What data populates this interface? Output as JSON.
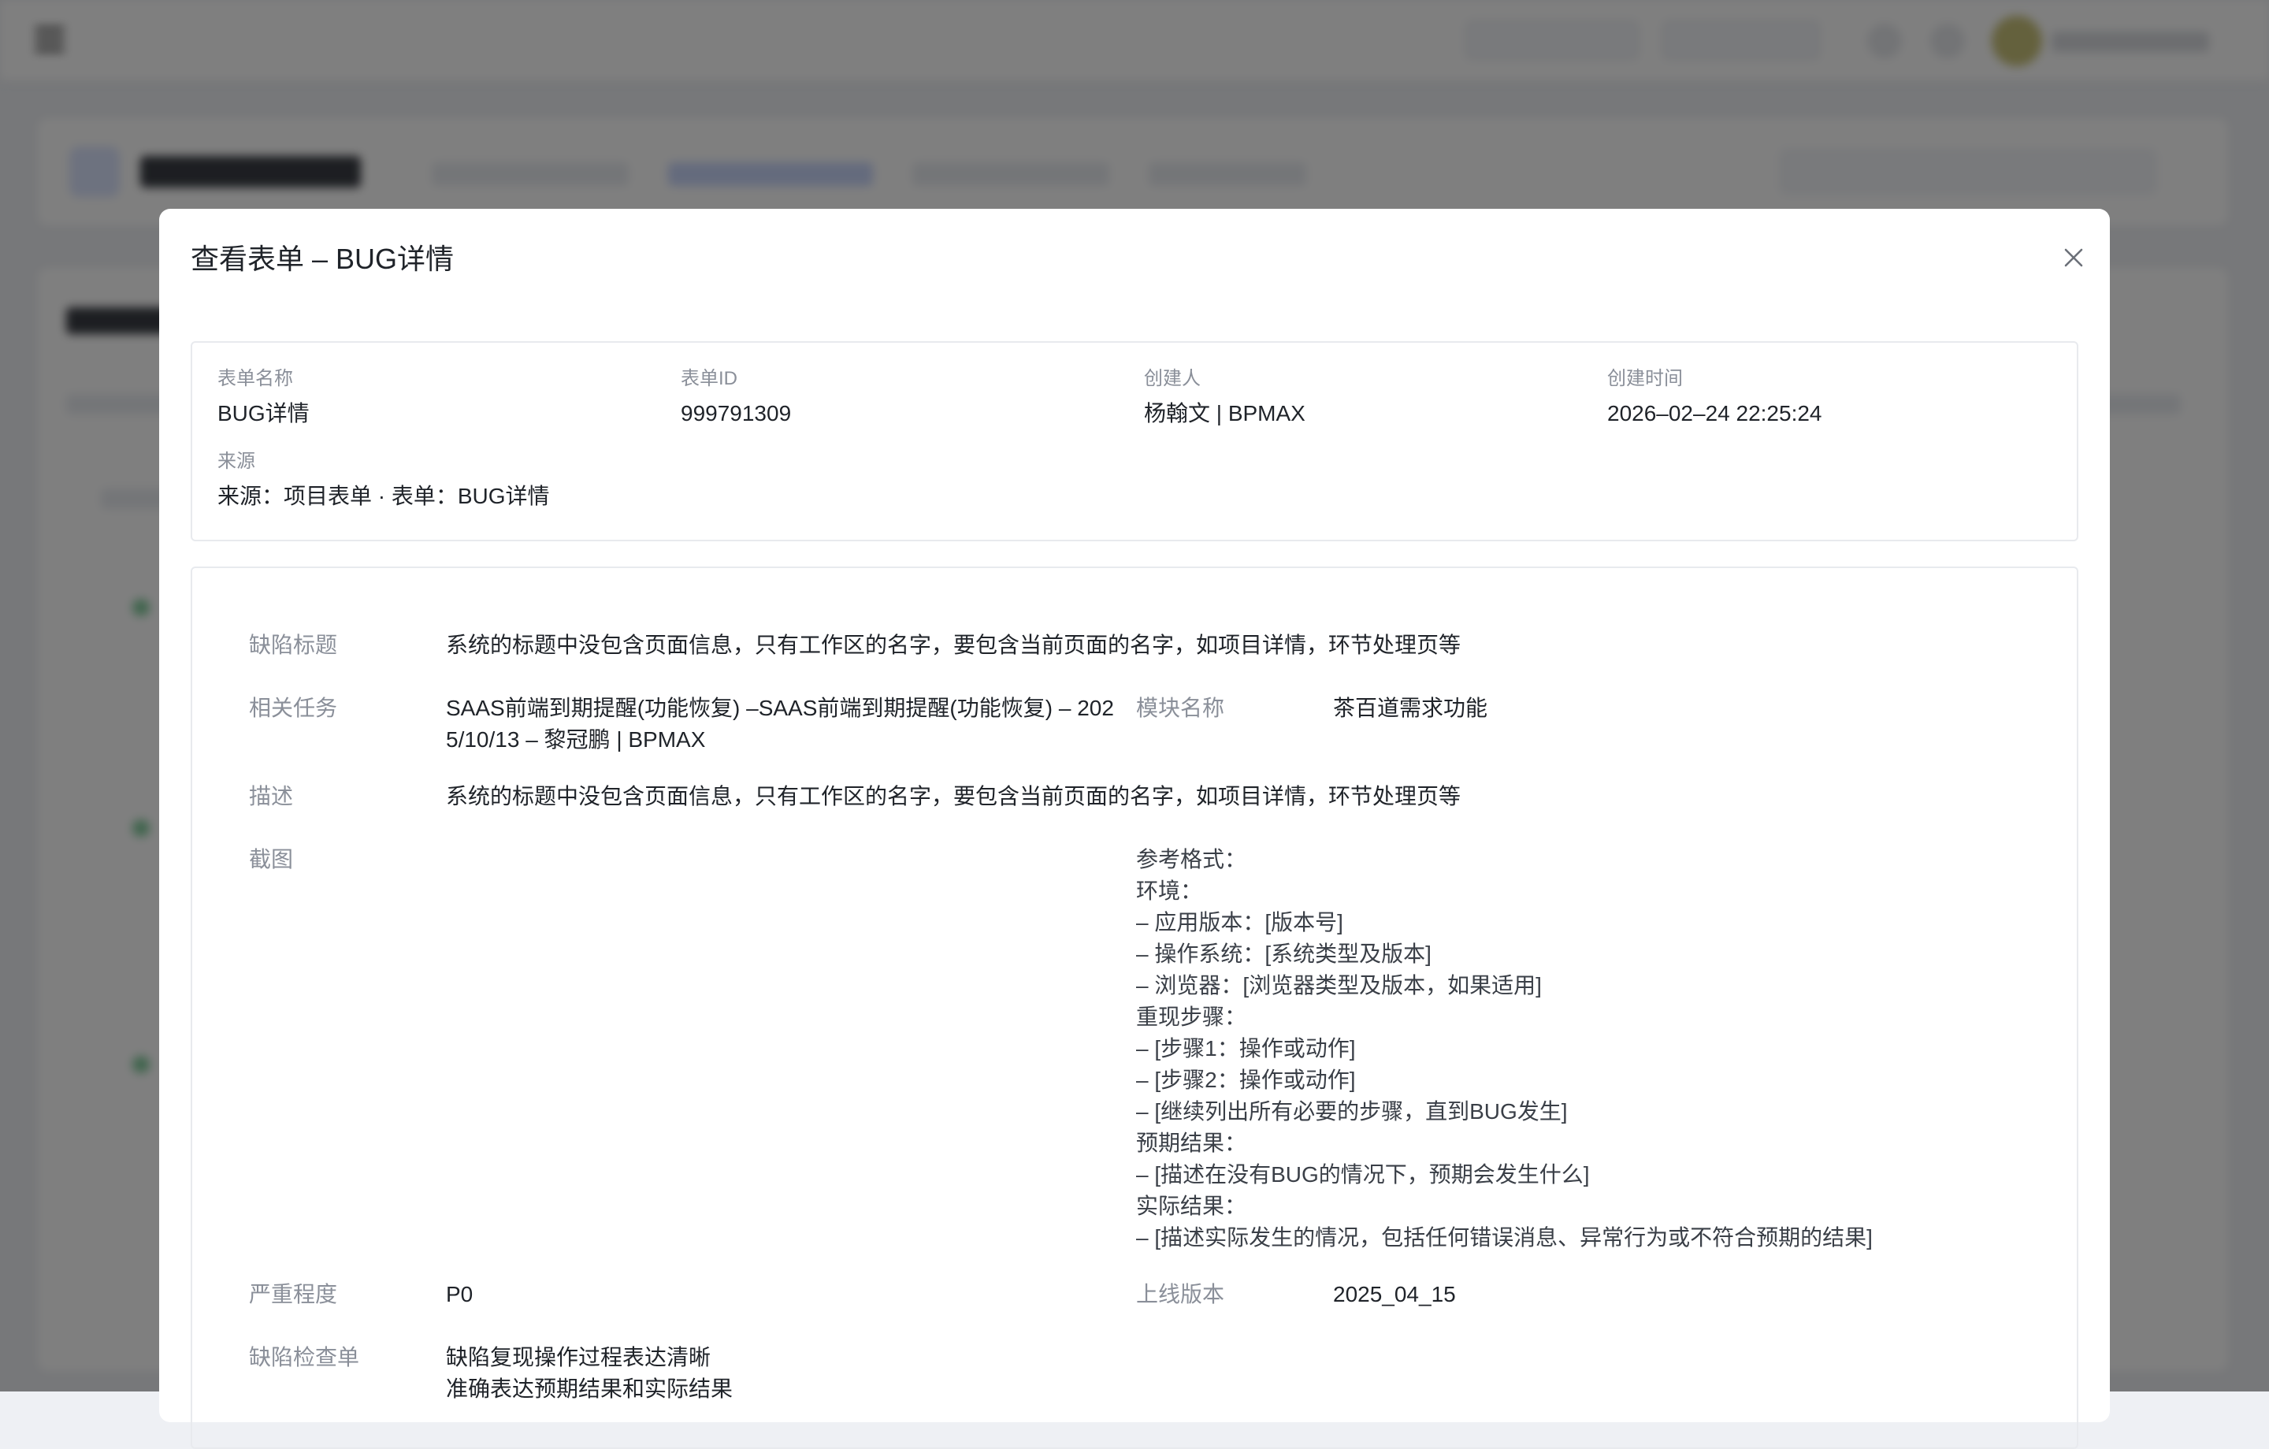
{
  "modal": {
    "title": "查看表单 – BUG详情"
  },
  "meta": {
    "form_name_label": "表单名称",
    "form_name": "BUG详情",
    "form_id_label": "表单ID",
    "form_id": "999791309",
    "creator_label": "创建人",
    "creator": "杨翰文 | BPMAX",
    "created_time_label": "创建时间",
    "created_time": "2026–02–24 22:25:24",
    "source_label": "来源",
    "source": "来源：项目表单 · 表单：BUG详情"
  },
  "form": {
    "defect_title_label": "缺陷标题",
    "defect_title": "系统的标题中没包含页面信息，只有工作区的名字，要包含当前页面的名字，如项目详情，环节处理页等",
    "related_task_label": "相关任务",
    "related_task_line1": "SAAS前端到期提醒(功能恢复) –SAAS前端到期提醒(功能恢复) – 202",
    "related_task_line2": "5/10/13 – 黎冠鹏 | BPMAX",
    "module_label": "模块名称",
    "module": "茶百道需求功能",
    "description_label": "描述",
    "description": "系统的标题中没包含页面信息，只有工作区的名字，要包含当前页面的名字，如项目详情，环节处理页等",
    "screenshot_label": "截图",
    "reference_lines": [
      "参考格式：",
      "环境：",
      "– 应用版本：[版本号]",
      "– 操作系统：[系统类型及版本]",
      "– 浏览器：[浏览器类型及版本，如果适用]",
      "重现步骤：",
      "– [步骤1：操作或动作]",
      "– [步骤2：操作或动作]",
      "– [继续列出所有必要的步骤，直到BUG发生]",
      "预期结果：",
      "– [描述在没有BUG的情况下，预期会发生什么]",
      "实际结果：",
      "– [描述实际发生的情况，包括任何错误消息、异常行为或不符合预期的结果]"
    ],
    "severity_label": "严重程度",
    "severity": "P0",
    "release_label": "上线版本",
    "release": "2025_04_15",
    "checklist_label": "缺陷检查单",
    "checklist_lines": [
      "缺陷复现操作过程表达清晰",
      "准确表达预期结果和实际结果"
    ]
  },
  "icons": {
    "close": "close-icon"
  }
}
